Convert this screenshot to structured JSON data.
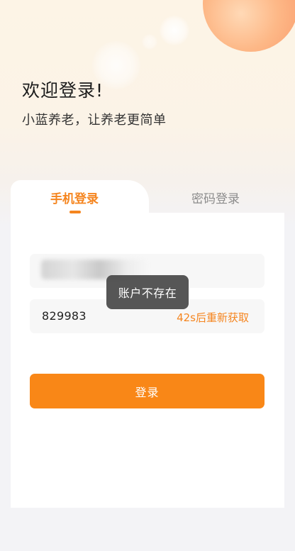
{
  "header": {
    "title": "欢迎登录!",
    "subtitle": "小蓝养老，让养老更简单"
  },
  "tabs": [
    {
      "label": "手机登录",
      "active": true
    },
    {
      "label": "密码登录",
      "active": false
    }
  ],
  "form": {
    "code_value": "829983",
    "resend_label": "42s后重新获取",
    "login_label": "登录"
  },
  "toast": {
    "message": "账户不存在"
  },
  "colors": {
    "accent": "#f98717",
    "tab_active": "#f5851f",
    "tab_inactive": "#8c8c8c",
    "toast_bg": "#484848"
  }
}
